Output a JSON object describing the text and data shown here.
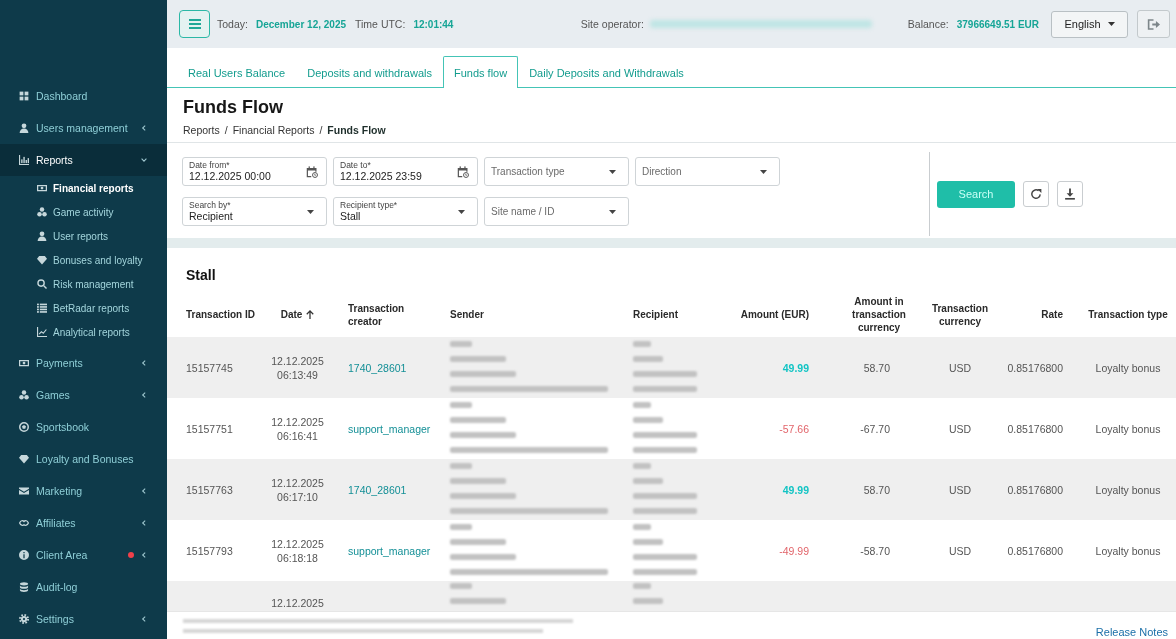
{
  "sidebar": {
    "items": [
      {
        "label": "Dashboard",
        "selected": false,
        "alert": false
      },
      {
        "label": "Users management",
        "selected": false,
        "expanded": false,
        "alert": false
      },
      {
        "label": "Reports",
        "selected": true,
        "expanded": true,
        "alert": false,
        "children": [
          {
            "label": "Financial reports",
            "selected": true
          },
          {
            "label": "Game activity",
            "selected": false
          },
          {
            "label": "User reports",
            "selected": false
          },
          {
            "label": "Bonuses and loyalty",
            "selected": false
          },
          {
            "label": "Risk management",
            "selected": false
          },
          {
            "label": "BetRadar reports",
            "selected": false
          },
          {
            "label": "Analytical reports",
            "selected": false
          }
        ]
      },
      {
        "label": "Payments",
        "selected": false,
        "expanded": false,
        "alert": false
      },
      {
        "label": "Games",
        "selected": false,
        "expanded": false,
        "alert": false
      },
      {
        "label": "Sportsbook",
        "selected": false,
        "alert": false
      },
      {
        "label": "Loyalty and Bonuses",
        "selected": false,
        "alert": false
      },
      {
        "label": "Marketing",
        "selected": false,
        "expanded": false,
        "alert": false
      },
      {
        "label": "Affiliates",
        "selected": false,
        "expanded": false,
        "alert": false
      },
      {
        "label": "Client Area",
        "selected": false,
        "expanded": false,
        "alert": true
      },
      {
        "label": "Audit-log",
        "selected": false,
        "alert": false
      },
      {
        "label": "Settings",
        "selected": false,
        "expanded": false,
        "alert": false
      }
    ]
  },
  "top_bar": {
    "today_label": "Today:",
    "today": "December 12, 2025",
    "time_label": "Time UTC:",
    "time": "12:01:44",
    "operator_label": "Site operator:",
    "balance_label": "Balance:",
    "balance": "37966649.51 EUR",
    "language": "English"
  },
  "tabs": [
    {
      "label": "Real Users Balance",
      "selected": false
    },
    {
      "label": "Deposits and withdrawals",
      "selected": false
    },
    {
      "label": "Funds flow",
      "selected": true
    },
    {
      "label": "Daily Deposits and Withdrawals",
      "selected": false
    }
  ],
  "page": {
    "title": "Funds Flow",
    "breadcrumb": {
      "separator": "/",
      "items": [
        {
          "label": "Reports",
          "current": false
        },
        {
          "label": "Financial Reports",
          "current": false
        },
        {
          "label": "Funds Flow",
          "current": true
        }
      ]
    }
  },
  "filters": {
    "fields": [
      {
        "kind": "date",
        "label": "Date from*",
        "value": "12.12.2025 00:00"
      },
      {
        "kind": "date",
        "label": "Date to*",
        "value": "12.12.2025 23:59"
      },
      {
        "kind": "select",
        "placeholder": "Transaction type"
      },
      {
        "kind": "select",
        "placeholder": "Direction"
      },
      {
        "kind": "select",
        "label": "Search by*",
        "value": "Recipient"
      },
      {
        "kind": "select",
        "label": "Recipient type*",
        "value": "Stall"
      },
      {
        "kind": "select",
        "placeholder": "Site name / ID"
      }
    ],
    "search_button": "Search"
  },
  "table": {
    "title": "Stall",
    "columns": [
      {
        "label": "Transaction ID",
        "sorted": false
      },
      {
        "label": "Date",
        "sorted": true
      },
      {
        "label": "Transaction creator",
        "sorted": false
      },
      {
        "label": "Sender",
        "sorted": false
      },
      {
        "label": "Recipient",
        "sorted": false
      },
      {
        "label": "Amount (EUR)",
        "sorted": false
      },
      {
        "label": "Amount in transaction currency",
        "sorted": false
      },
      {
        "label": "Transaction currency",
        "sorted": false
      },
      {
        "label": "Rate",
        "sorted": false
      },
      {
        "label": "Transaction type",
        "sorted": false
      }
    ],
    "rows": [
      {
        "id": "15157745",
        "date": "12.12.2025",
        "time": "06:13:49",
        "creator": "1740_28601",
        "amount": "49.99",
        "credit": true,
        "amount_tx": "58.70",
        "currency": "USD",
        "rate": "0.85176800",
        "type": "Loyalty bonus"
      },
      {
        "id": "15157751",
        "date": "12.12.2025",
        "time": "06:16:41",
        "creator": "support_manager",
        "amount": "-57.66",
        "credit": false,
        "amount_tx": "-67.70",
        "currency": "USD",
        "rate": "0.85176800",
        "type": "Loyalty bonus"
      },
      {
        "id": "15157763",
        "date": "12.12.2025",
        "time": "06:17:10",
        "creator": "1740_28601",
        "amount": "49.99",
        "credit": true,
        "amount_tx": "58.70",
        "currency": "USD",
        "rate": "0.85176800",
        "type": "Loyalty bonus"
      },
      {
        "id": "15157793",
        "date": "12.12.2025",
        "time": "06:18:18",
        "creator": "support_manager",
        "amount": "-49.99",
        "credit": false,
        "amount_tx": "-58.70",
        "currency": "USD",
        "rate": "0.85176800",
        "type": "Loyalty bonus"
      },
      {
        "date": "12.12.2025"
      }
    ]
  },
  "footer": {
    "release_notes": "Release Notes"
  }
}
